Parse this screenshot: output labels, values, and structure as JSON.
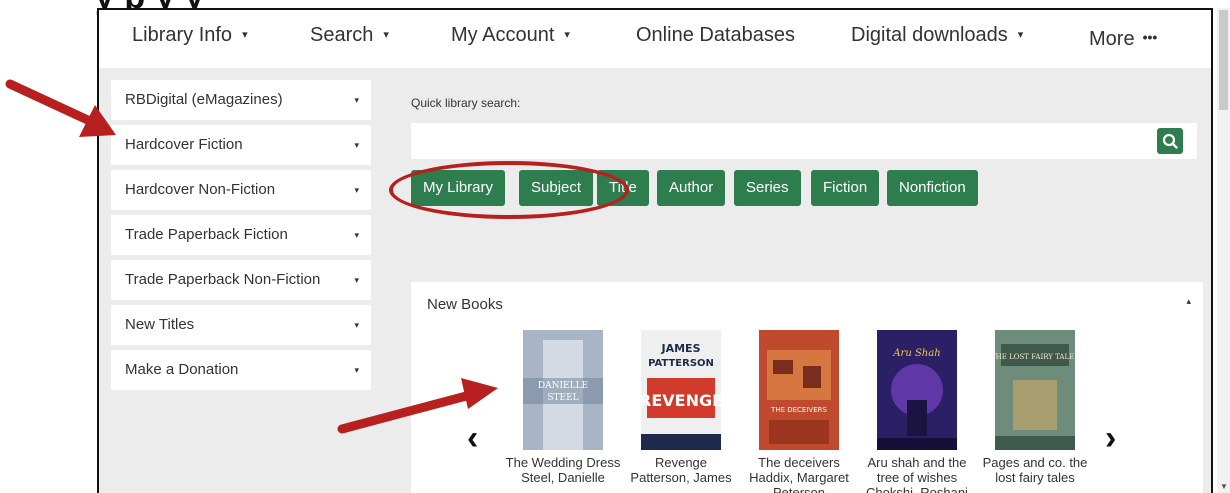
{
  "heading_fragment": "y p           y y",
  "nav": {
    "items": [
      {
        "label": "Library Info",
        "has_caret": true
      },
      {
        "label": "Search",
        "has_caret": true
      },
      {
        "label": "My Account",
        "has_caret": true
      },
      {
        "label": "Online Databases",
        "has_caret": false
      },
      {
        "label": "Digital downloads",
        "has_caret": true
      },
      {
        "label": "More",
        "has_caret": false
      }
    ],
    "more_dots": "•••",
    "caret": "▾"
  },
  "sidebar": {
    "items": [
      {
        "label": "RBDigital (eMagazines)"
      },
      {
        "label": "Hardcover Fiction"
      },
      {
        "label": "Hardcover Non-Fiction"
      },
      {
        "label": "Trade Paperback Fiction"
      },
      {
        "label": "Trade Paperback Non-Fiction"
      },
      {
        "label": "New Titles"
      },
      {
        "label": "Make a Donation"
      }
    ],
    "caret": "▾"
  },
  "search": {
    "label": "Quick library search:",
    "placeholder": "",
    "value": "",
    "button_icon": "search-icon"
  },
  "chips": [
    {
      "label": "My Library"
    },
    {
      "label": "Subject"
    },
    {
      "label": "Title"
    },
    {
      "label": "Author"
    },
    {
      "label": "Series"
    },
    {
      "label": "Fiction"
    },
    {
      "label": "Nonfiction"
    }
  ],
  "new_books": {
    "title": "New Books",
    "collapse_caret": "▴",
    "prev": "‹",
    "next": "›",
    "books": [
      {
        "title": "The Wedding Dress",
        "author": "Steel, Danielle",
        "cover_text": "DANIELLE STEEL",
        "cover_color": "#8a9bb3"
      },
      {
        "title": "Revenge",
        "author": "Patterson, James",
        "cover_text": "JAMES PATTERSON REVENGE",
        "cover_color": "#c0302b"
      },
      {
        "title": "The deceivers",
        "author": "Haddix, Margaret Peterson",
        "cover_text": "THE DECEIVERS",
        "cover_color": "#b9432c"
      },
      {
        "title": "Aru shah and the tree of wishes",
        "author": "Chokshi, Roshani",
        "cover_text": "Aru Shah",
        "cover_color": "#3b2a7a"
      },
      {
        "title": "Pages and co. the lost fairy tales",
        "author": "",
        "cover_text": "THE LOST FAIRY TALES",
        "cover_color": "#5a7a6a"
      }
    ]
  },
  "colors": {
    "accent_green": "#2e7d4f",
    "annotation_red": "#b81f1f"
  }
}
